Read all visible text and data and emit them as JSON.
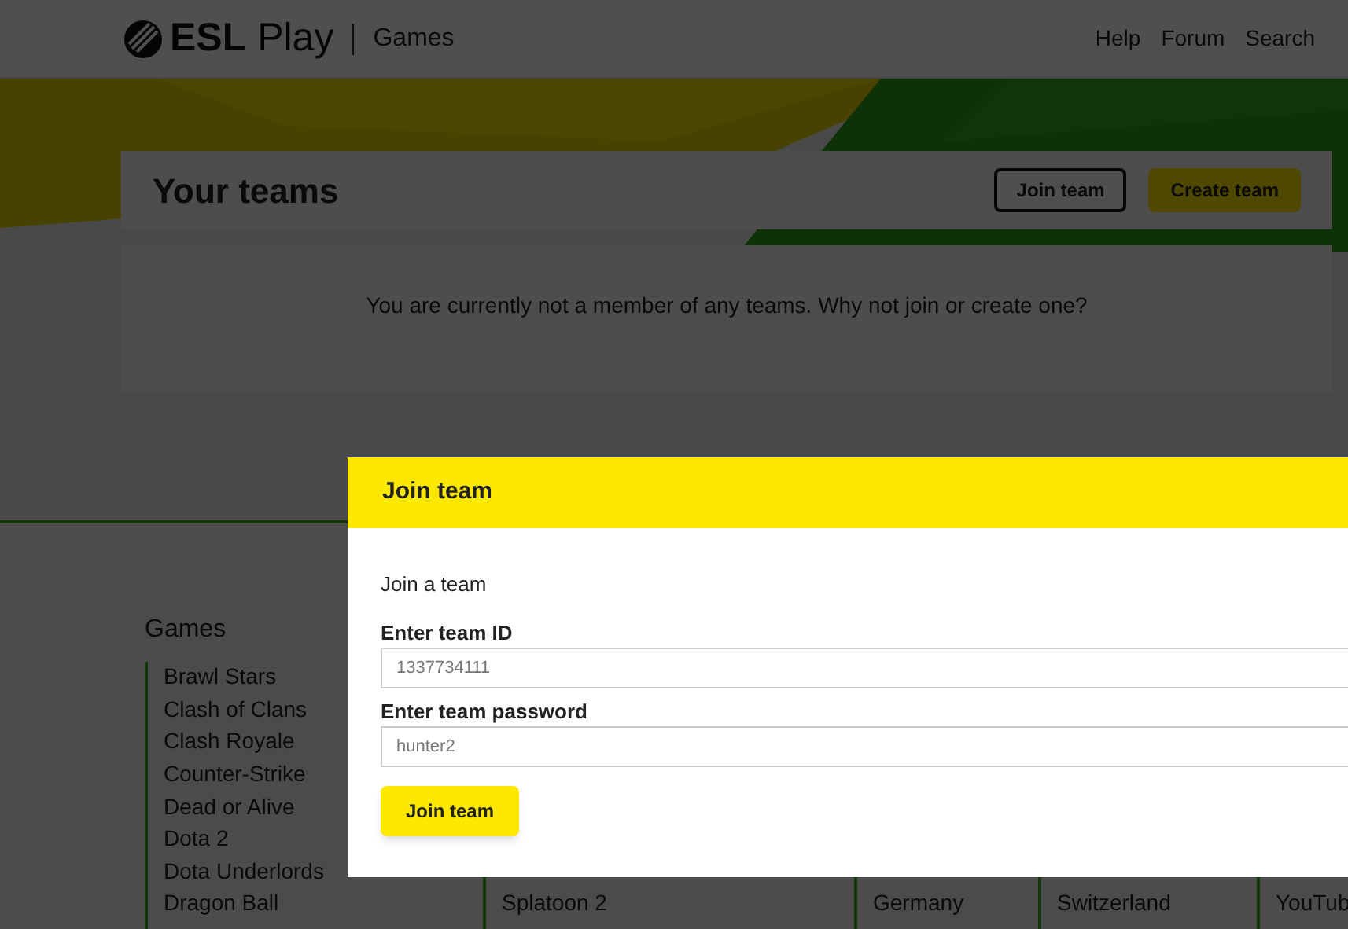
{
  "header": {
    "logo": "**ESL** Play",
    "section": "Games",
    "nav": [
      "Help",
      "Forum",
      "Search"
    ]
  },
  "teams": {
    "title": "Your teams",
    "buttons": [
      {
        "label": "Join team",
        "kind": "outline"
      },
      {
        "label": "Create team",
        "kind": "primary"
      }
    ],
    "message": "You are currently not a member of any teams. Why not join or create one?"
  },
  "footer": {
    "columns": [
      {
        "heading": "Games",
        "items": [
          "Brawl Stars",
          "Clash of Clans",
          "Clash Royale",
          "Counter-Strike",
          "Dead or Alive",
          "Dota 2",
          "Dota Underlords",
          "Dragon Ball"
        ]
      },
      {
        "items": [
          "Splatoon 2"
        ]
      },
      {
        "items": [
          "Germany"
        ]
      },
      {
        "items": [
          "Switzerland"
        ]
      },
      {
        "items": [
          "YouTub"
        ]
      }
    ]
  },
  "dialog": {
    "title": "Join team",
    "intro": "Join a team",
    "fields": [
      {
        "label": "Enter team ID",
        "placeholder": "1337734111"
      },
      {
        "label": "Enter team password",
        "placeholder": "hunter2"
      }
    ],
    "submit": "Join team"
  }
}
